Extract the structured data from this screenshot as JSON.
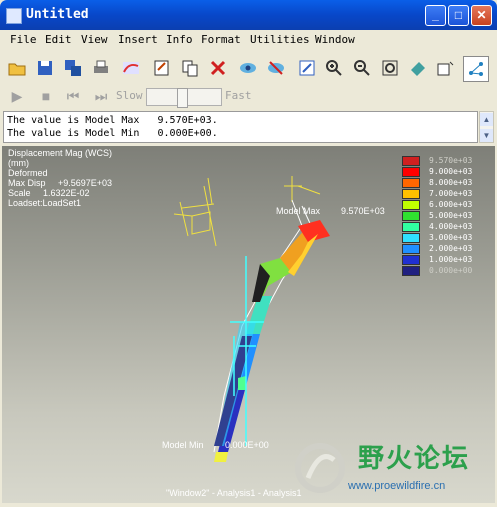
{
  "window": {
    "title": "Untitled"
  },
  "menu": [
    "File",
    "Edit",
    "View",
    "Insert",
    "Info",
    "Format",
    "Utilities",
    "Window"
  ],
  "animation": {
    "slow_label": "Slow",
    "fast_label": "Fast"
  },
  "messages": [
    "The value is Model Max   9.570E+03.",
    "The value is Model Min   0.000E+00."
  ],
  "result_info": {
    "lines": [
      "Displacement Mag (WCS)",
      "(mm)",
      "Deformed",
      "Max Disp     +9.5697E+03",
      "Scale     1.6322E-02",
      "Loadset:LoadSet1"
    ]
  },
  "legend": [
    {
      "value": "9.570e+03",
      "color": "#d02020"
    },
    {
      "value": "9.000e+03",
      "color": "#ff0000"
    },
    {
      "value": "8.000e+03",
      "color": "#ff6600"
    },
    {
      "value": "7.000e+03",
      "color": "#ffc000"
    },
    {
      "value": "6.000e+03",
      "color": "#c0ff00"
    },
    {
      "value": "5.000e+03",
      "color": "#30e030"
    },
    {
      "value": "4.000e+03",
      "color": "#30ffa0"
    },
    {
      "value": "3.000e+03",
      "color": "#30e0ff"
    },
    {
      "value": "2.000e+03",
      "color": "#2090ff"
    },
    {
      "value": "1.000e+03",
      "color": "#2030d0"
    },
    {
      "value": "0.000e+00",
      "color": "#202080"
    }
  ],
  "model_labels": {
    "max_name": "Model Max",
    "max_value": "9.570E+03",
    "min_name": "Model Min",
    "min_value": "0.000E+00"
  },
  "footer": "\"Window2\" - Analysis1 - Analysis1",
  "watermark": {
    "text": "野火论坛",
    "url": "www.proewildfire.cn"
  }
}
